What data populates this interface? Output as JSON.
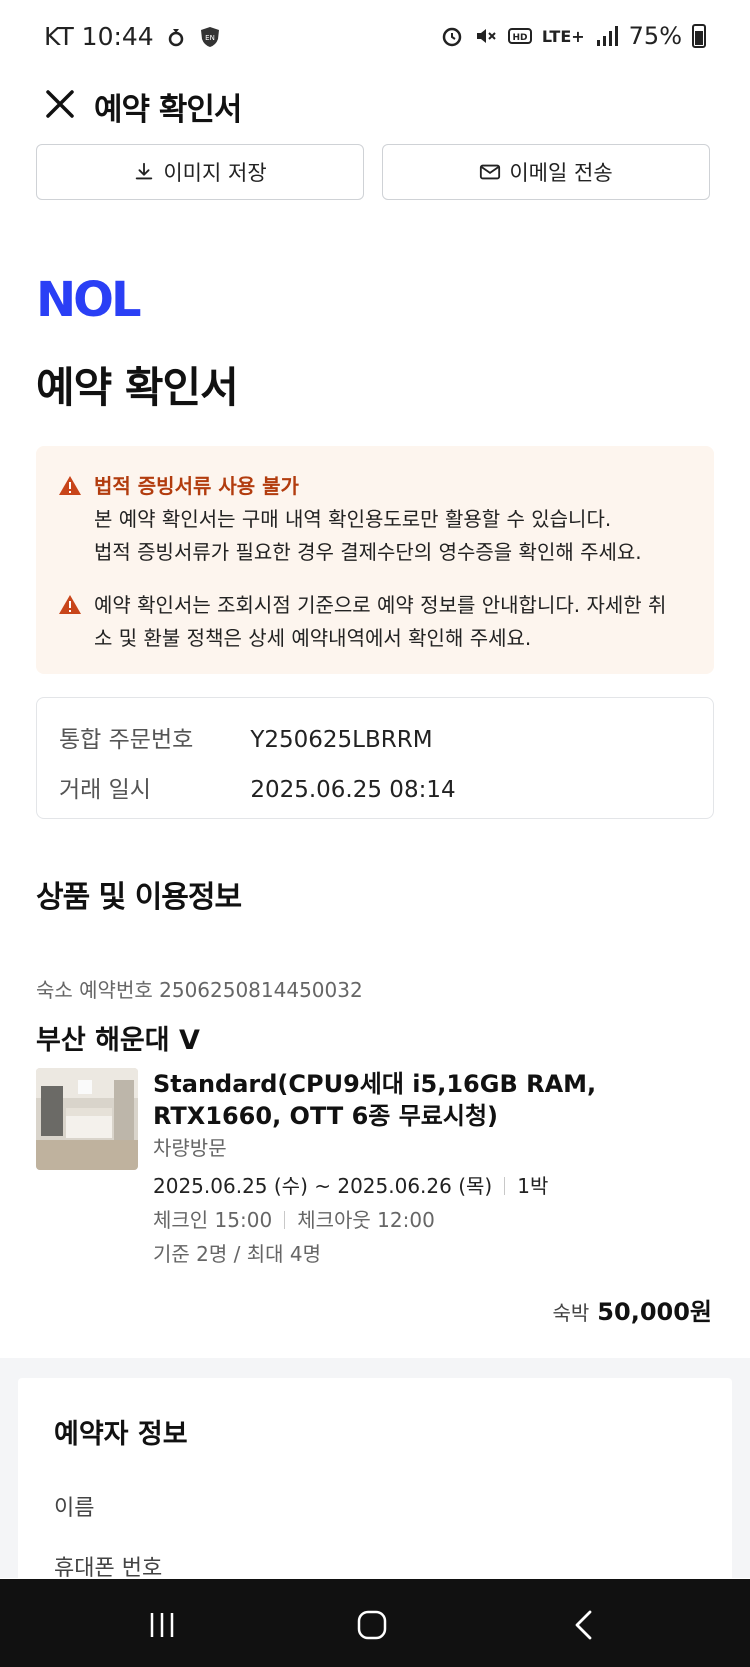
{
  "status_bar": {
    "carrier_time": "KT 10:44",
    "network": "LTE+",
    "battery": "75%"
  },
  "header": {
    "title": "예약 확인서"
  },
  "actions": {
    "save_image": "이미지 저장",
    "send_email": "이메일 전송"
  },
  "brand": {
    "logo_text": "NOL",
    "logo_color": "#2a3ff5"
  },
  "page_title": "예약 확인서",
  "notice": {
    "title": "법적 증빙서류 사용 불가",
    "line1": "본 예약 확인서는 구매 내역 확인용도로만 활용할 수 있습니다.",
    "line2": "법적 증빙서류가 필요한 경우 결제수단의 영수증을 확인해 주세요.",
    "item2_line1": "예약 확인서는 조회시점 기준으로 예약 정보를 안내합니다. 자세한 취",
    "item2_line2": "소 및 환불 정책은 상세 예약내역에서 확인해 주세요."
  },
  "order": {
    "order_no_label": "통합 주문번호",
    "order_no": "Y250625LBRRM",
    "date_label": "거래 일시",
    "date": "2025.06.25 08:14"
  },
  "product_section": {
    "title": "상품 및 이용정보",
    "reservation_no": "숙소 예약번호 2506250814450032",
    "hotel_name": "부산 해운대 V",
    "room_name": "Standard(CPU9세대 i5,16GB RAM, RTX1660, OTT 6종 무료시청)",
    "visit_type": "차량방문",
    "date_range": "2025.06.25 (수) ~ 2025.06.26 (목)",
    "nights": "1박",
    "check_in": "체크인 15:00",
    "check_out": "체크아웃 12:00",
    "guests": "기준 2명 / 최대 4명",
    "price_label": "숙박",
    "price": "50,000원"
  },
  "booker": {
    "title": "예약자 정보",
    "name_label": "이름",
    "phone_label": "휴대폰 번호"
  }
}
